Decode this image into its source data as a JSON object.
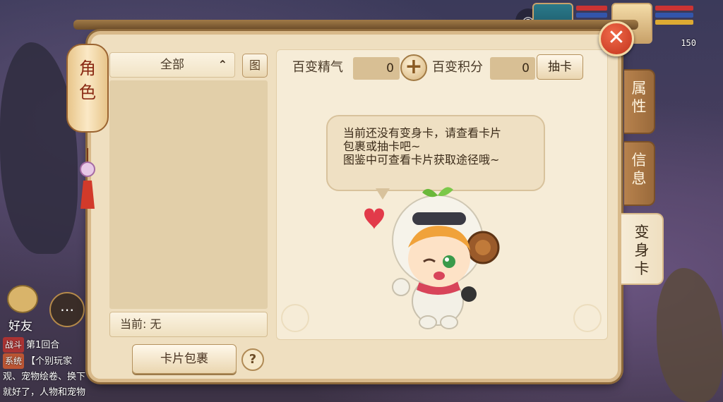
{
  "hud": {
    "level": "150",
    "friend_label": "好友",
    "chat": [
      {
        "tag": "战斗",
        "text": "第1回合"
      },
      {
        "tag": "系统",
        "text": "【个别玩家观、宠物绘卷、换下就好了，人物和宠物"
      }
    ]
  },
  "panel": {
    "title": "角色",
    "filter": {
      "selected": "全部"
    },
    "atlas_button": "图",
    "current_label": "当前: 无",
    "card_bag_button": "卡片包裹",
    "help_button": "?"
  },
  "stats": {
    "essence_label": "百变精气",
    "essence_value": "0",
    "points_label": "百变积分",
    "points_value": "0",
    "draw_button": "抽卡"
  },
  "message": {
    "line1": "当前还没有变身卡，请查看卡片",
    "line2": "包裹或抽卡吧~",
    "line3": "图鉴中可查看卡片获取途径哦~"
  },
  "tabs": [
    {
      "label": "属性",
      "active": false
    },
    {
      "label": "信息",
      "active": false
    },
    {
      "label": "变身卡",
      "active": true
    }
  ],
  "icons": {
    "close": "close-icon",
    "plus": "plus-icon",
    "chevron": "chevron-up-icon",
    "camera": "camera-icon",
    "chat": "chat-bubble-icon"
  },
  "colors": {
    "panel_bg": "#efdfc0",
    "tab_bg": "#b7824d",
    "close_red": "#c2331c"
  }
}
